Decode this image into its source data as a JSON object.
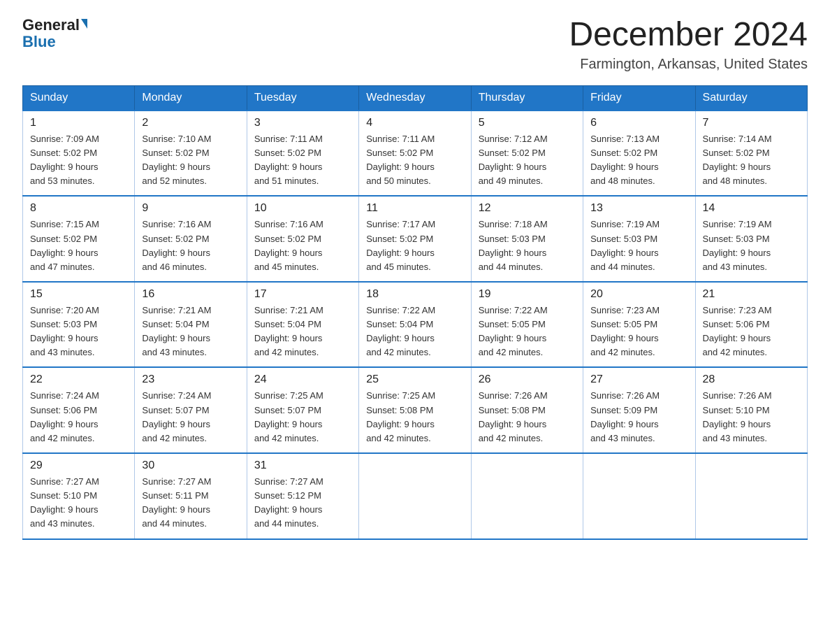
{
  "header": {
    "logo_general": "General",
    "logo_blue": "Blue",
    "month_title": "December 2024",
    "location": "Farmington, Arkansas, United States"
  },
  "days_of_week": [
    "Sunday",
    "Monday",
    "Tuesday",
    "Wednesday",
    "Thursday",
    "Friday",
    "Saturday"
  ],
  "weeks": [
    [
      {
        "day": "1",
        "sunrise": "7:09 AM",
        "sunset": "5:02 PM",
        "daylight": "9 hours and 53 minutes."
      },
      {
        "day": "2",
        "sunrise": "7:10 AM",
        "sunset": "5:02 PM",
        "daylight": "9 hours and 52 minutes."
      },
      {
        "day": "3",
        "sunrise": "7:11 AM",
        "sunset": "5:02 PM",
        "daylight": "9 hours and 51 minutes."
      },
      {
        "day": "4",
        "sunrise": "7:11 AM",
        "sunset": "5:02 PM",
        "daylight": "9 hours and 50 minutes."
      },
      {
        "day": "5",
        "sunrise": "7:12 AM",
        "sunset": "5:02 PM",
        "daylight": "9 hours and 49 minutes."
      },
      {
        "day": "6",
        "sunrise": "7:13 AM",
        "sunset": "5:02 PM",
        "daylight": "9 hours and 48 minutes."
      },
      {
        "day": "7",
        "sunrise": "7:14 AM",
        "sunset": "5:02 PM",
        "daylight": "9 hours and 48 minutes."
      }
    ],
    [
      {
        "day": "8",
        "sunrise": "7:15 AM",
        "sunset": "5:02 PM",
        "daylight": "9 hours and 47 minutes."
      },
      {
        "day": "9",
        "sunrise": "7:16 AM",
        "sunset": "5:02 PM",
        "daylight": "9 hours and 46 minutes."
      },
      {
        "day": "10",
        "sunrise": "7:16 AM",
        "sunset": "5:02 PM",
        "daylight": "9 hours and 45 minutes."
      },
      {
        "day": "11",
        "sunrise": "7:17 AM",
        "sunset": "5:02 PM",
        "daylight": "9 hours and 45 minutes."
      },
      {
        "day": "12",
        "sunrise": "7:18 AM",
        "sunset": "5:03 PM",
        "daylight": "9 hours and 44 minutes."
      },
      {
        "day": "13",
        "sunrise": "7:19 AM",
        "sunset": "5:03 PM",
        "daylight": "9 hours and 44 minutes."
      },
      {
        "day": "14",
        "sunrise": "7:19 AM",
        "sunset": "5:03 PM",
        "daylight": "9 hours and 43 minutes."
      }
    ],
    [
      {
        "day": "15",
        "sunrise": "7:20 AM",
        "sunset": "5:03 PM",
        "daylight": "9 hours and 43 minutes."
      },
      {
        "day": "16",
        "sunrise": "7:21 AM",
        "sunset": "5:04 PM",
        "daylight": "9 hours and 43 minutes."
      },
      {
        "day": "17",
        "sunrise": "7:21 AM",
        "sunset": "5:04 PM",
        "daylight": "9 hours and 42 minutes."
      },
      {
        "day": "18",
        "sunrise": "7:22 AM",
        "sunset": "5:04 PM",
        "daylight": "9 hours and 42 minutes."
      },
      {
        "day": "19",
        "sunrise": "7:22 AM",
        "sunset": "5:05 PM",
        "daylight": "9 hours and 42 minutes."
      },
      {
        "day": "20",
        "sunrise": "7:23 AM",
        "sunset": "5:05 PM",
        "daylight": "9 hours and 42 minutes."
      },
      {
        "day": "21",
        "sunrise": "7:23 AM",
        "sunset": "5:06 PM",
        "daylight": "9 hours and 42 minutes."
      }
    ],
    [
      {
        "day": "22",
        "sunrise": "7:24 AM",
        "sunset": "5:06 PM",
        "daylight": "9 hours and 42 minutes."
      },
      {
        "day": "23",
        "sunrise": "7:24 AM",
        "sunset": "5:07 PM",
        "daylight": "9 hours and 42 minutes."
      },
      {
        "day": "24",
        "sunrise": "7:25 AM",
        "sunset": "5:07 PM",
        "daylight": "9 hours and 42 minutes."
      },
      {
        "day": "25",
        "sunrise": "7:25 AM",
        "sunset": "5:08 PM",
        "daylight": "9 hours and 42 minutes."
      },
      {
        "day": "26",
        "sunrise": "7:26 AM",
        "sunset": "5:08 PM",
        "daylight": "9 hours and 42 minutes."
      },
      {
        "day": "27",
        "sunrise": "7:26 AM",
        "sunset": "5:09 PM",
        "daylight": "9 hours and 43 minutes."
      },
      {
        "day": "28",
        "sunrise": "7:26 AM",
        "sunset": "5:10 PM",
        "daylight": "9 hours and 43 minutes."
      }
    ],
    [
      {
        "day": "29",
        "sunrise": "7:27 AM",
        "sunset": "5:10 PM",
        "daylight": "9 hours and 43 minutes."
      },
      {
        "day": "30",
        "sunrise": "7:27 AM",
        "sunset": "5:11 PM",
        "daylight": "9 hours and 44 minutes."
      },
      {
        "day": "31",
        "sunrise": "7:27 AM",
        "sunset": "5:12 PM",
        "daylight": "9 hours and 44 minutes."
      },
      null,
      null,
      null,
      null
    ]
  ],
  "labels": {
    "sunrise": "Sunrise:",
    "sunset": "Sunset:",
    "daylight": "Daylight:"
  }
}
